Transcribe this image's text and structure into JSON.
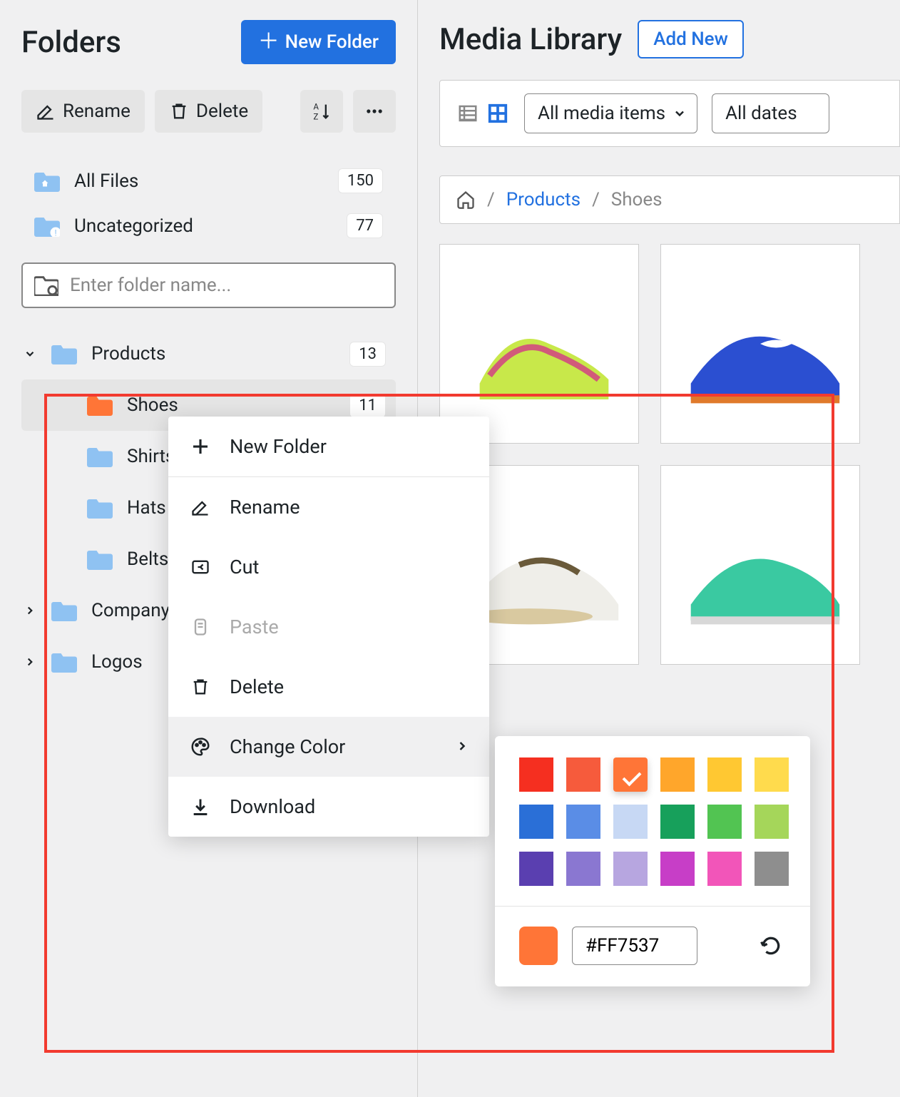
{
  "sidebar": {
    "title": "Folders",
    "new_folder_btn": "New Folder",
    "rename_btn": "Rename",
    "delete_btn": "Delete",
    "quick": {
      "all_files": {
        "label": "All Files",
        "count": "150"
      },
      "uncategorized": {
        "label": "Uncategorized",
        "count": "77"
      }
    },
    "search_placeholder": "Enter folder name...",
    "tree": {
      "products": {
        "label": "Products",
        "count": "13"
      },
      "shoes": {
        "label": "Shoes",
        "count": "11"
      },
      "shirts": {
        "label": "Shirts"
      },
      "hats": {
        "label": "Hats"
      },
      "belts": {
        "label": "Belts"
      },
      "company": {
        "label": "Company P"
      },
      "logos": {
        "label": "Logos"
      }
    }
  },
  "right": {
    "title": "Media Library",
    "add_new_btn": "Add New",
    "filters": {
      "type": "All media items",
      "date": "All dates"
    },
    "breadcrumb": {
      "products": "Products",
      "shoes": "Shoes"
    }
  },
  "ctx": {
    "new_folder": "New Folder",
    "rename": "Rename",
    "cut": "Cut",
    "paste": "Paste",
    "delete": "Delete",
    "change_color": "Change Color",
    "download": "Download"
  },
  "picker": {
    "hex": "#FF7537",
    "swatches": [
      "#f52f20",
      "#f65b3c",
      "#ff7537",
      "#ffa62b",
      "#ffc832",
      "#ffdb4d",
      "#2a6fd7",
      "#5a8de6",
      "#c7d8f4",
      "#17a05b",
      "#52c452",
      "#a5d65a",
      "#5a3fb0",
      "#8a77d1",
      "#b7a6e0",
      "#c73ec7",
      "#f255b9",
      "#8e8e8e"
    ],
    "selected_index": 2
  }
}
